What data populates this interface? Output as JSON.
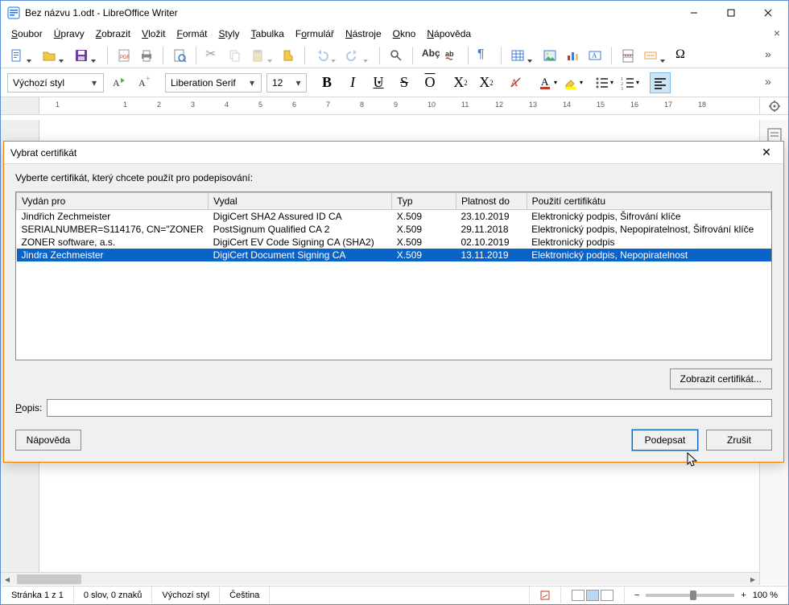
{
  "window": {
    "title": "Bez názvu 1.odt - LibreOffice Writer"
  },
  "menubar": {
    "items": [
      "Soubor",
      "Úpravy",
      "Zobrazit",
      "Vložit",
      "Formát",
      "Styly",
      "Tabulka",
      "Formulář",
      "Nástroje",
      "Okno",
      "Nápověda"
    ],
    "underline_index": [
      0,
      0,
      0,
      0,
      0,
      0,
      0,
      1,
      0,
      0,
      0
    ]
  },
  "formatbar": {
    "style": "Výchozí styl",
    "font": "Liberation Serif",
    "size": "12"
  },
  "ruler": {
    "marks": [
      "1",
      "",
      "1",
      "2",
      "3",
      "4",
      "5",
      "6",
      "7",
      "8",
      "9",
      "10",
      "11",
      "12",
      "13",
      "14",
      "15",
      "16",
      "17",
      "18"
    ]
  },
  "statusbar": {
    "page": "Stránka 1 z 1",
    "words": "0 slov, 0 znaků",
    "style": "Výchozí styl",
    "lang": "Čeština",
    "zoom": "100 %"
  },
  "dialog": {
    "title": "Vybrat certifikát",
    "instruction": "Vyberte certifikát, který chcete použít pro podepisování:",
    "columns": [
      "Vydán pro",
      "Vydal",
      "Typ",
      "Platnost do",
      "Použití certifikátu"
    ],
    "rows": [
      {
        "for": "Jindřich Zechmeister",
        "by": "DigiCert SHA2 Assured ID CA",
        "type": "X.509",
        "valid": "23.10.2019",
        "usage": "Elektronický podpis, Šifrování klíče",
        "selected": false
      },
      {
        "for": "SERIALNUMBER=S114176, CN=\"ZONER",
        "by": "PostSignum Qualified CA 2",
        "type": "X.509",
        "valid": "29.11.2018",
        "usage": "Elektronický podpis, Nepopiratelnost, Šifrování klíče",
        "selected": false
      },
      {
        "for": "ZONER software, a.s.",
        "by": "DigiCert EV Code Signing CA (SHA2)",
        "type": "X.509",
        "valid": "02.10.2019",
        "usage": "Elektronický podpis",
        "selected": false
      },
      {
        "for": "Jindra Zechmeister",
        "by": "DigiCert Document Signing CA",
        "type": "X.509",
        "valid": "13.11.2019",
        "usage": "Elektronický podpis, Nepopiratelnost",
        "selected": true
      }
    ],
    "show_cert_btn": "Zobrazit certifikát...",
    "desc_label": "Popis:",
    "desc_value": "",
    "help_btn": "Nápověda",
    "sign_btn": "Podepsat",
    "cancel_btn": "Zrušit"
  }
}
